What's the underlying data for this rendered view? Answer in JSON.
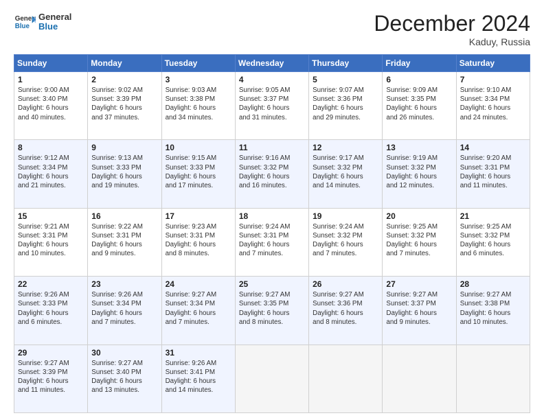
{
  "logo": {
    "line1": "General",
    "line2": "Blue"
  },
  "header": {
    "month": "December 2024",
    "location": "Kaduy, Russia"
  },
  "weekdays": [
    "Sunday",
    "Monday",
    "Tuesday",
    "Wednesday",
    "Thursday",
    "Friday",
    "Saturday"
  ],
  "weeks": [
    [
      {
        "day": "1",
        "info": "Sunrise: 9:00 AM\nSunset: 3:40 PM\nDaylight: 6 hours\nand 40 minutes."
      },
      {
        "day": "2",
        "info": "Sunrise: 9:02 AM\nSunset: 3:39 PM\nDaylight: 6 hours\nand 37 minutes."
      },
      {
        "day": "3",
        "info": "Sunrise: 9:03 AM\nSunset: 3:38 PM\nDaylight: 6 hours\nand 34 minutes."
      },
      {
        "day": "4",
        "info": "Sunrise: 9:05 AM\nSunset: 3:37 PM\nDaylight: 6 hours\nand 31 minutes."
      },
      {
        "day": "5",
        "info": "Sunrise: 9:07 AM\nSunset: 3:36 PM\nDaylight: 6 hours\nand 29 minutes."
      },
      {
        "day": "6",
        "info": "Sunrise: 9:09 AM\nSunset: 3:35 PM\nDaylight: 6 hours\nand 26 minutes."
      },
      {
        "day": "7",
        "info": "Sunrise: 9:10 AM\nSunset: 3:34 PM\nDaylight: 6 hours\nand 24 minutes."
      }
    ],
    [
      {
        "day": "8",
        "info": "Sunrise: 9:12 AM\nSunset: 3:34 PM\nDaylight: 6 hours\nand 21 minutes."
      },
      {
        "day": "9",
        "info": "Sunrise: 9:13 AM\nSunset: 3:33 PM\nDaylight: 6 hours\nand 19 minutes."
      },
      {
        "day": "10",
        "info": "Sunrise: 9:15 AM\nSunset: 3:33 PM\nDaylight: 6 hours\nand 17 minutes."
      },
      {
        "day": "11",
        "info": "Sunrise: 9:16 AM\nSunset: 3:32 PM\nDaylight: 6 hours\nand 16 minutes."
      },
      {
        "day": "12",
        "info": "Sunrise: 9:17 AM\nSunset: 3:32 PM\nDaylight: 6 hours\nand 14 minutes."
      },
      {
        "day": "13",
        "info": "Sunrise: 9:19 AM\nSunset: 3:32 PM\nDaylight: 6 hours\nand 12 minutes."
      },
      {
        "day": "14",
        "info": "Sunrise: 9:20 AM\nSunset: 3:31 PM\nDaylight: 6 hours\nand 11 minutes."
      }
    ],
    [
      {
        "day": "15",
        "info": "Sunrise: 9:21 AM\nSunset: 3:31 PM\nDaylight: 6 hours\nand 10 minutes."
      },
      {
        "day": "16",
        "info": "Sunrise: 9:22 AM\nSunset: 3:31 PM\nDaylight: 6 hours\nand 9 minutes."
      },
      {
        "day": "17",
        "info": "Sunrise: 9:23 AM\nSunset: 3:31 PM\nDaylight: 6 hours\nand 8 minutes."
      },
      {
        "day": "18",
        "info": "Sunrise: 9:24 AM\nSunset: 3:31 PM\nDaylight: 6 hours\nand 7 minutes."
      },
      {
        "day": "19",
        "info": "Sunrise: 9:24 AM\nSunset: 3:32 PM\nDaylight: 6 hours\nand 7 minutes."
      },
      {
        "day": "20",
        "info": "Sunrise: 9:25 AM\nSunset: 3:32 PM\nDaylight: 6 hours\nand 7 minutes."
      },
      {
        "day": "21",
        "info": "Sunrise: 9:25 AM\nSunset: 3:32 PM\nDaylight: 6 hours\nand 6 minutes."
      }
    ],
    [
      {
        "day": "22",
        "info": "Sunrise: 9:26 AM\nSunset: 3:33 PM\nDaylight: 6 hours\nand 6 minutes."
      },
      {
        "day": "23",
        "info": "Sunrise: 9:26 AM\nSunset: 3:34 PM\nDaylight: 6 hours\nand 7 minutes."
      },
      {
        "day": "24",
        "info": "Sunrise: 9:27 AM\nSunset: 3:34 PM\nDaylight: 6 hours\nand 7 minutes."
      },
      {
        "day": "25",
        "info": "Sunrise: 9:27 AM\nSunset: 3:35 PM\nDaylight: 6 hours\nand 8 minutes."
      },
      {
        "day": "26",
        "info": "Sunrise: 9:27 AM\nSunset: 3:36 PM\nDaylight: 6 hours\nand 8 minutes."
      },
      {
        "day": "27",
        "info": "Sunrise: 9:27 AM\nSunset: 3:37 PM\nDaylight: 6 hours\nand 9 minutes."
      },
      {
        "day": "28",
        "info": "Sunrise: 9:27 AM\nSunset: 3:38 PM\nDaylight: 6 hours\nand 10 minutes."
      }
    ],
    [
      {
        "day": "29",
        "info": "Sunrise: 9:27 AM\nSunset: 3:39 PM\nDaylight: 6 hours\nand 11 minutes."
      },
      {
        "day": "30",
        "info": "Sunrise: 9:27 AM\nSunset: 3:40 PM\nDaylight: 6 hours\nand 13 minutes."
      },
      {
        "day": "31",
        "info": "Sunrise: 9:26 AM\nSunset: 3:41 PM\nDaylight: 6 hours\nand 14 minutes."
      },
      {
        "day": "",
        "info": ""
      },
      {
        "day": "",
        "info": ""
      },
      {
        "day": "",
        "info": ""
      },
      {
        "day": "",
        "info": ""
      }
    ]
  ]
}
